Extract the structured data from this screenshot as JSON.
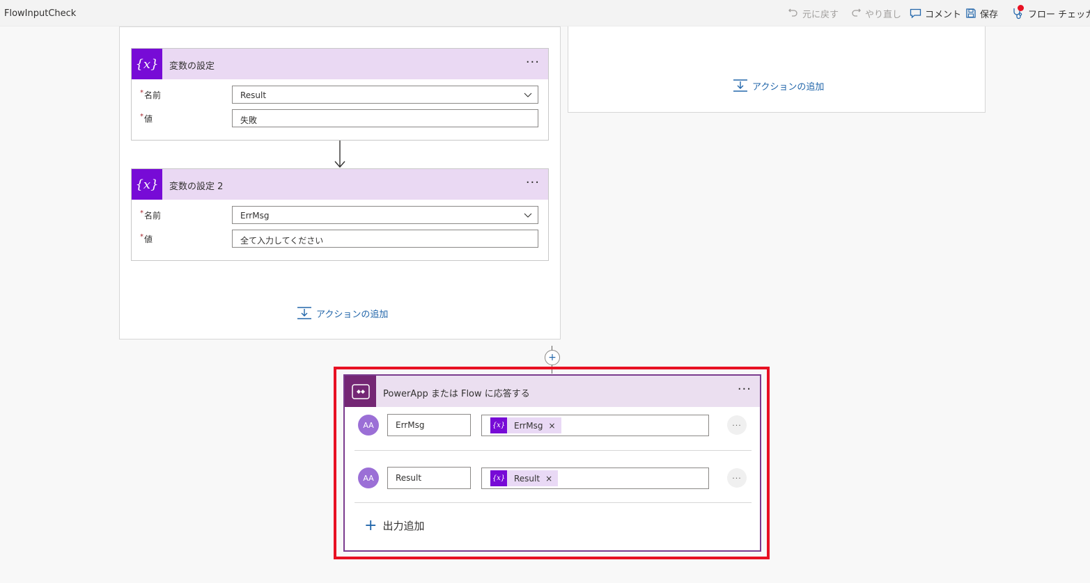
{
  "app": {
    "title": "FlowInputCheck"
  },
  "toolbar": {
    "undo_label": "元に戻す",
    "redo_label": "やり直し",
    "comment_label": "コメント",
    "save_label": "保存",
    "checker_label": "フロー チェッカー"
  },
  "cards": [
    {
      "title": "変数の設定",
      "icon_text": "{x}",
      "name_label": "名前",
      "name_value": "Result",
      "value_label": "値",
      "value_value": "失敗",
      "more": "···"
    },
    {
      "title": "変数の設定 2",
      "icon_text": "{x}",
      "name_label": "名前",
      "name_value": "ErrMsg",
      "value_label": "値",
      "value_value": "全て入力してください",
      "more": "···"
    }
  ],
  "required_marker": "*",
  "add_action_label": "アクションの追加",
  "response": {
    "title": "PowerApp または Flow に応答する",
    "more": "···",
    "outputs": [
      {
        "avatar": "AA",
        "name": "ErrMsg",
        "token": "ErrMsg",
        "token_icon": "{x}",
        "close": "×",
        "more": "···"
      },
      {
        "avatar": "AA",
        "name": "Result",
        "token": "Result",
        "token_icon": "{x}",
        "close": "×",
        "more": "···"
      }
    ],
    "add_output_plus": "+",
    "add_output_label": "出力追加"
  },
  "connector_plus": "+",
  "colors": {
    "variable_purple": "#770bd6",
    "header_lavender": "#ead9f3",
    "powerapps_purple": "#742774",
    "highlight_red": "#e81123",
    "link_blue": "#2266aa"
  }
}
